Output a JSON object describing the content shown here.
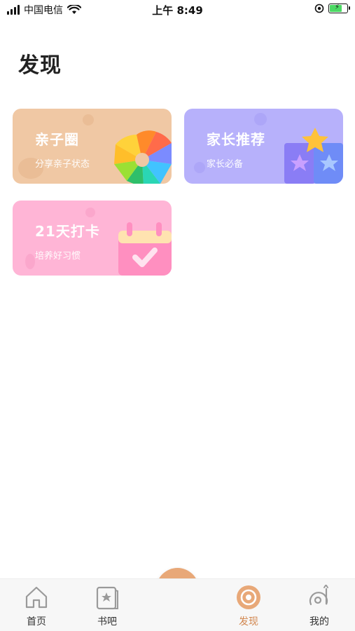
{
  "status_bar": {
    "carrier": "中国电信",
    "time": "上午 8:49"
  },
  "page": {
    "title": "发现"
  },
  "cards": [
    {
      "title": "亲子圈",
      "subtitle": "分享亲子状态",
      "color": "#f0c8a4",
      "icon": "heart-pinwheel-icon"
    },
    {
      "title": "家长推荐",
      "subtitle": "家长必备",
      "color": "#b7b1fb",
      "icon": "star-blocks-icon"
    },
    {
      "title": "21天打卡",
      "subtitle": "培养好习惯",
      "color": "#ffb5d6",
      "icon": "calendar-check-icon"
    }
  ],
  "tabbar": {
    "items": [
      {
        "label": "首页",
        "icon": "home-icon"
      },
      {
        "label": "书吧",
        "icon": "book-star-icon"
      },
      {
        "label": "发现",
        "icon": "discover-icon",
        "active": true
      },
      {
        "label": "我的",
        "icon": "profile-icon"
      }
    ],
    "center_button_icon": "plus-icon",
    "active_color": "#d1864e"
  }
}
